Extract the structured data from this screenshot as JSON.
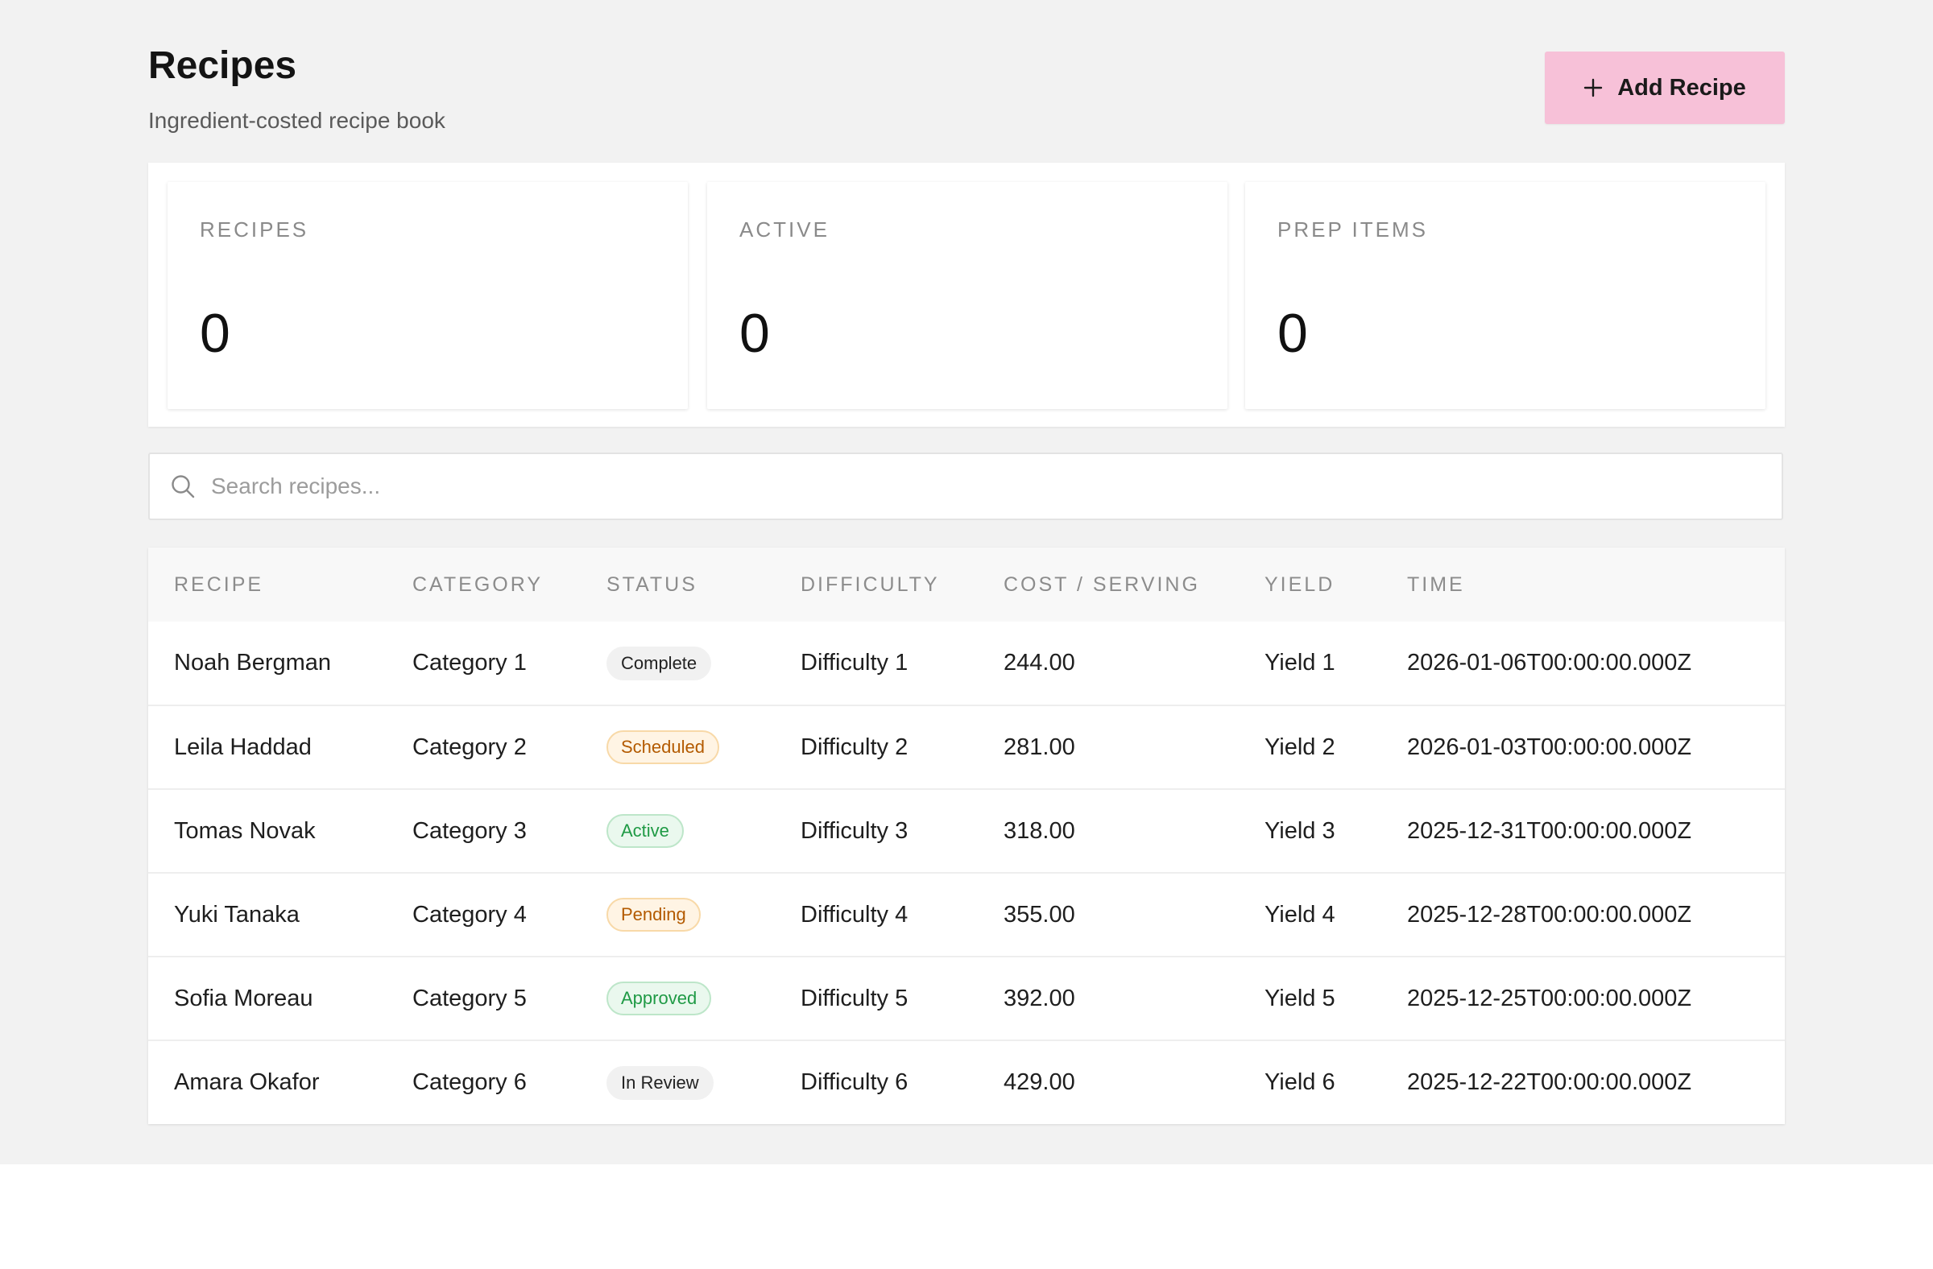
{
  "header": {
    "title": "Recipes",
    "subtitle": "Ingredient-costed recipe book",
    "add_button_label": "Add Recipe",
    "add_button_icon": "plus-icon"
  },
  "stats": [
    {
      "label": "RECIPES",
      "value": "0"
    },
    {
      "label": "ACTIVE",
      "value": "0"
    },
    {
      "label": "PREP ITEMS",
      "value": "0"
    }
  ],
  "search": {
    "placeholder": "Search recipes...",
    "value": "",
    "icon": "search-icon"
  },
  "table": {
    "columns": [
      "RECIPE",
      "CATEGORY",
      "STATUS",
      "DIFFICULTY",
      "COST / SERVING",
      "YIELD",
      "TIME"
    ],
    "rows": [
      {
        "recipe": "Noah Bergman",
        "category": "Category 1",
        "status": "Complete",
        "difficulty": "Difficulty 1",
        "cost": "244.00",
        "yield": "Yield 1",
        "time": "2026-01-06T00:00:00.000Z"
      },
      {
        "recipe": "Leila Haddad",
        "category": "Category 2",
        "status": "Scheduled",
        "difficulty": "Difficulty 2",
        "cost": "281.00",
        "yield": "Yield 2",
        "time": "2026-01-03T00:00:00.000Z"
      },
      {
        "recipe": "Tomas Novak",
        "category": "Category 3",
        "status": "Active",
        "difficulty": "Difficulty 3",
        "cost": "318.00",
        "yield": "Yield 3",
        "time": "2025-12-31T00:00:00.000Z"
      },
      {
        "recipe": "Yuki Tanaka",
        "category": "Category 4",
        "status": "Pending",
        "difficulty": "Difficulty 4",
        "cost": "355.00",
        "yield": "Yield 4",
        "time": "2025-12-28T00:00:00.000Z"
      },
      {
        "recipe": "Sofia Moreau",
        "category": "Category 5",
        "status": "Approved",
        "difficulty": "Difficulty 5",
        "cost": "392.00",
        "yield": "Yield 5",
        "time": "2025-12-25T00:00:00.000Z"
      },
      {
        "recipe": "Amara Okafor",
        "category": "Category 6",
        "status": "In Review",
        "difficulty": "Difficulty 6",
        "cost": "429.00",
        "yield": "Yield 6",
        "time": "2025-12-22T00:00:00.000Z"
      }
    ]
  },
  "colors": {
    "page_background": "#f2f2f2",
    "accent_button": "#f7c1d8",
    "status_warning_text": "#b35a00",
    "status_success_text": "#1f9a45"
  }
}
